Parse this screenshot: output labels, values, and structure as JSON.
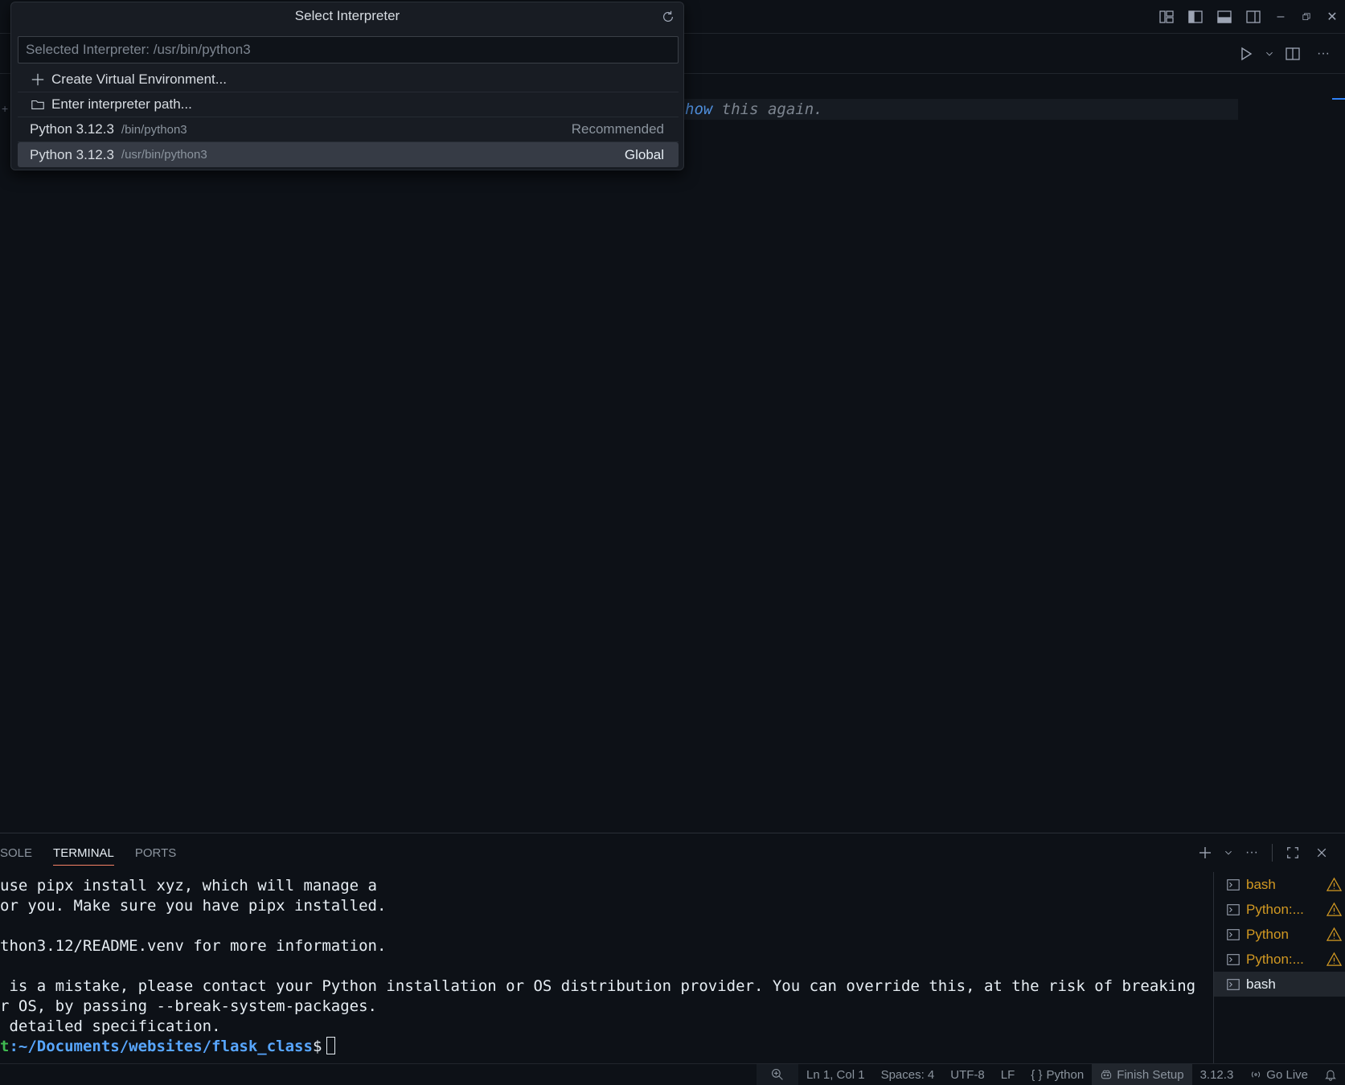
{
  "quickpick": {
    "title": "Select Interpreter",
    "input_placeholder": "Selected Interpreter: /usr/bin/python3",
    "items": [
      {
        "label": "Create Virtual Environment...",
        "icon": "plus-icon"
      },
      {
        "label": "Enter interpreter path...",
        "icon": "folder-icon"
      },
      {
        "label": "Python 3.12.3",
        "description": "/bin/python3",
        "detail": "Recommended"
      },
      {
        "label": "Python 3.12.3",
        "description": "/usr/bin/python3",
        "detail": "Global",
        "selected": true
      }
    ]
  },
  "editor": {
    "ghost_keyword": "how",
    "ghost_rest": " this again."
  },
  "panel": {
    "tabs": [
      "SOLE",
      "TERMINAL",
      "PORTS"
    ],
    "active_tab": "TERMINAL"
  },
  "terminal": {
    "lines": [
      "use pipx install xyz, which will manage a",
      "or you. Make sure you have pipx installed.",
      "",
      "thon3.12/README.venv for more information.",
      "",
      " is a mistake, please contact your Python installation or OS distribution provider. You can override this, at the risk of breaking",
      "r OS, by passing --break-system-packages.",
      " detailed specification."
    ],
    "prompt_user": "t",
    "prompt_path": ":~/Documents/websites/flask_class",
    "prompt_symbol": "$"
  },
  "terminal_list": [
    {
      "label": "bash",
      "warning": true
    },
    {
      "label": "Python:...",
      "warning": true
    },
    {
      "label": "Python",
      "warning": true
    },
    {
      "label": "Python:...",
      "warning": true
    },
    {
      "label": "bash",
      "warning": false,
      "active": true
    }
  ],
  "statusbar": {
    "position": "Ln 1, Col 1",
    "spaces": "Spaces: 4",
    "encoding": "UTF-8",
    "eol": "LF",
    "language": "Python",
    "language_icon": "{ }",
    "finish_setup": "Finish Setup",
    "python_version": "3.12.3",
    "go_live": "Go Live"
  }
}
